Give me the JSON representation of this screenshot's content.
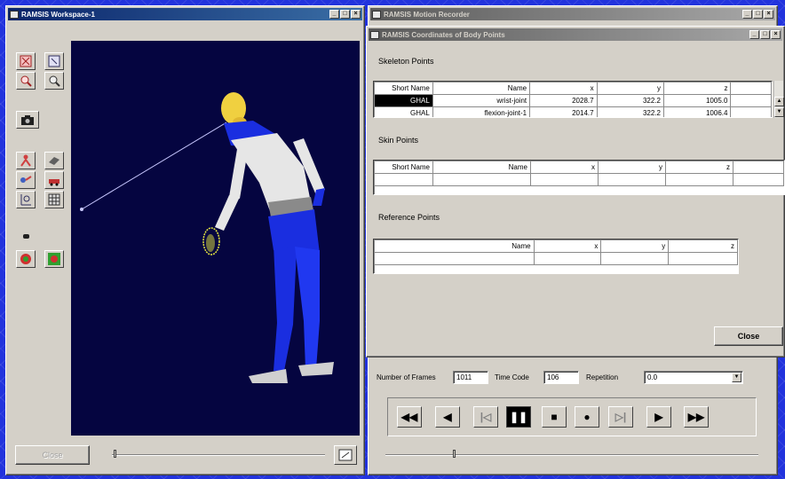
{
  "workspace": {
    "title": "RAMSIS Workspace-1",
    "close_label": "Close"
  },
  "motion_recorder": {
    "title": "RAMSIS Motion Recorder",
    "frames_label": "Number of Frames",
    "frames_value": "1011",
    "timecode_label": "Time Code",
    "timecode_value": "106",
    "repetition_label": "Repetition",
    "repetition_value": "0.0",
    "transport": [
      "⏮",
      "◀",
      "⏮",
      "⏸",
      "■",
      "●",
      "⏭",
      "▶",
      "⏭"
    ]
  },
  "coords": {
    "title": "RAMSIS Coordinates of Body Points",
    "skeleton_label": "Skeleton Points",
    "skeleton_headers": [
      "Short Name",
      "Name",
      "x",
      "y",
      "z"
    ],
    "skeleton_row": [
      "GHAL",
      "wrist-joint",
      "2028.7",
      "322.2",
      "1005.0"
    ],
    "skeleton_row_partial": [
      "GHAL",
      "flexion-joint-1",
      "2014.7",
      "322.2",
      "1006.4"
    ],
    "skin_label": "Skin Points",
    "skin_headers": [
      "Short Name",
      "Name",
      "x",
      "y",
      "z"
    ],
    "reference_label": "Reference Points",
    "reference_headers": [
      "Name",
      "x",
      "y",
      "z"
    ],
    "close_label": "Close"
  },
  "colors": {
    "desktop": "#2233dd",
    "titlebar_active": "#0a246a",
    "viewport_bg": "#050540",
    "figure_blue": "#1a2ee0",
    "figure_white": "#e6e6e6",
    "head_yellow": "#f0d040"
  }
}
